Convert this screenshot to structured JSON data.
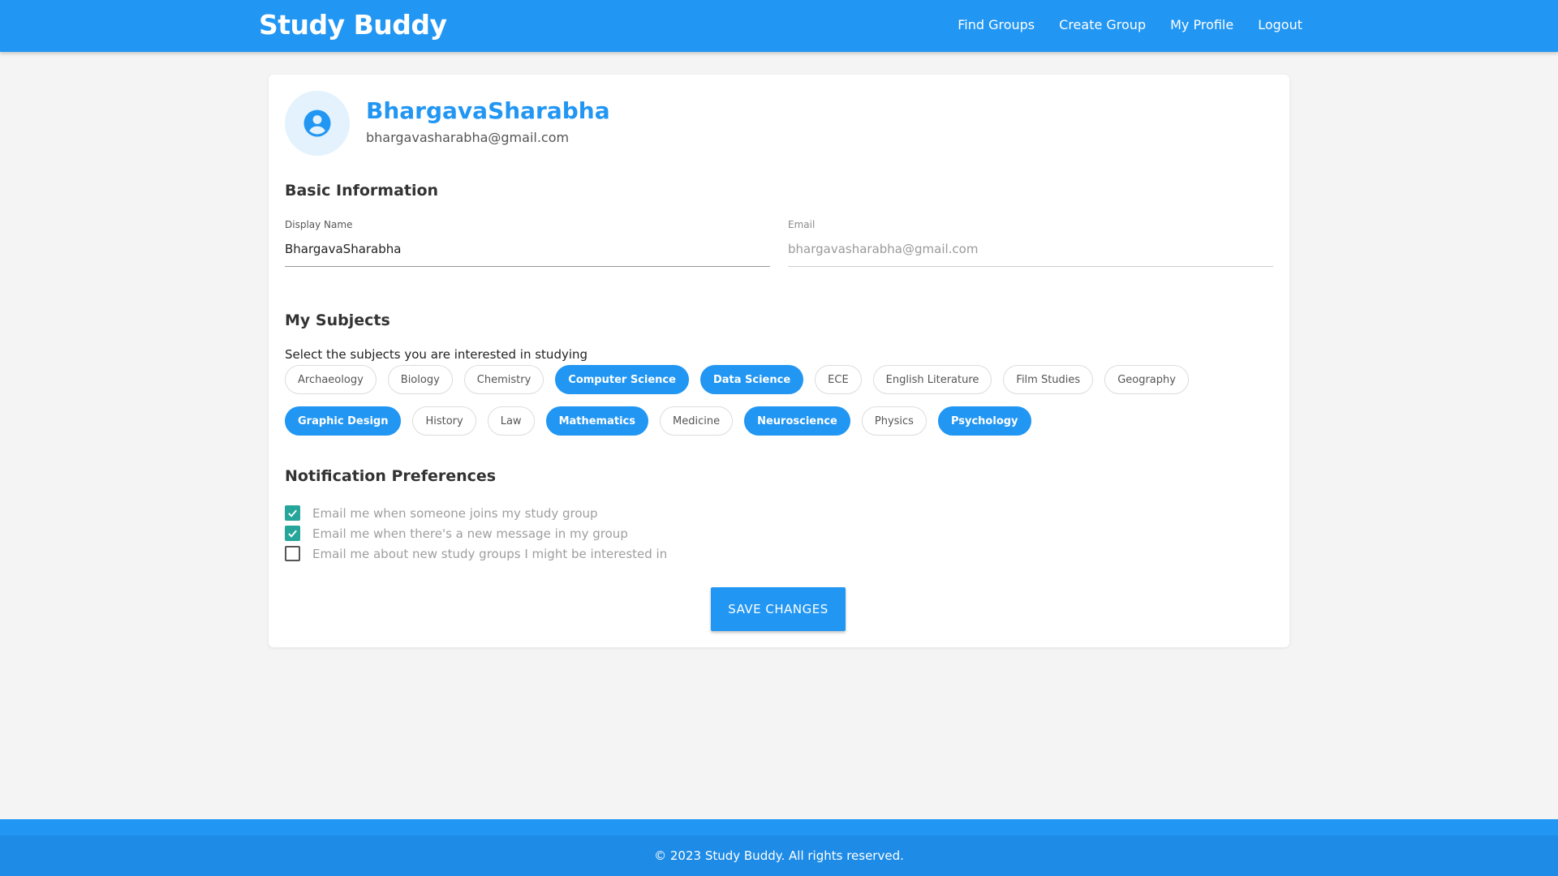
{
  "nav": {
    "brand": "Study Buddy",
    "links": [
      "Find Groups",
      "Create Group",
      "My Profile",
      "Logout"
    ]
  },
  "profile": {
    "name": "BhargavaSharabha",
    "email": "bhargavasharabha@gmail.com"
  },
  "basic_info": {
    "title": "Basic Information",
    "display_name_label": "Display Name",
    "display_name_value": "BhargavaSharabha",
    "email_label": "Email",
    "email_value": "bhargavasharabha@gmail.com"
  },
  "subjects": {
    "title": "My Subjects",
    "intro": "Select the subjects you are interested in studying",
    "items": [
      {
        "label": "Archaeology",
        "selected": false
      },
      {
        "label": "Biology",
        "selected": false
      },
      {
        "label": "Chemistry",
        "selected": false
      },
      {
        "label": "Computer Science",
        "selected": true
      },
      {
        "label": "Data Science",
        "selected": true
      },
      {
        "label": "ECE",
        "selected": false
      },
      {
        "label": "English Literature",
        "selected": false
      },
      {
        "label": "Film Studies",
        "selected": false
      },
      {
        "label": "Geography",
        "selected": false
      },
      {
        "label": "Graphic Design",
        "selected": true
      },
      {
        "label": "History",
        "selected": false
      },
      {
        "label": "Law",
        "selected": false
      },
      {
        "label": "Mathematics",
        "selected": true
      },
      {
        "label": "Medicine",
        "selected": false
      },
      {
        "label": "Neuroscience",
        "selected": true
      },
      {
        "label": "Physics",
        "selected": false
      },
      {
        "label": "Psychology",
        "selected": true
      }
    ]
  },
  "notifications": {
    "title": "Notification Preferences",
    "items": [
      {
        "label": "Email me when someone joins my study group",
        "checked": true
      },
      {
        "label": "Email me when there's a new message in my group",
        "checked": true
      },
      {
        "label": "Email me about new study groups I might be interested in",
        "checked": false
      }
    ]
  },
  "save_label": "SAVE CHANGES",
  "footer": "© 2023 Study Buddy. All rights reserved.",
  "colors": {
    "primary": "#2196f3",
    "checkbox_checked": "#26a69a",
    "avatar_bg": "#e3f2fd"
  }
}
